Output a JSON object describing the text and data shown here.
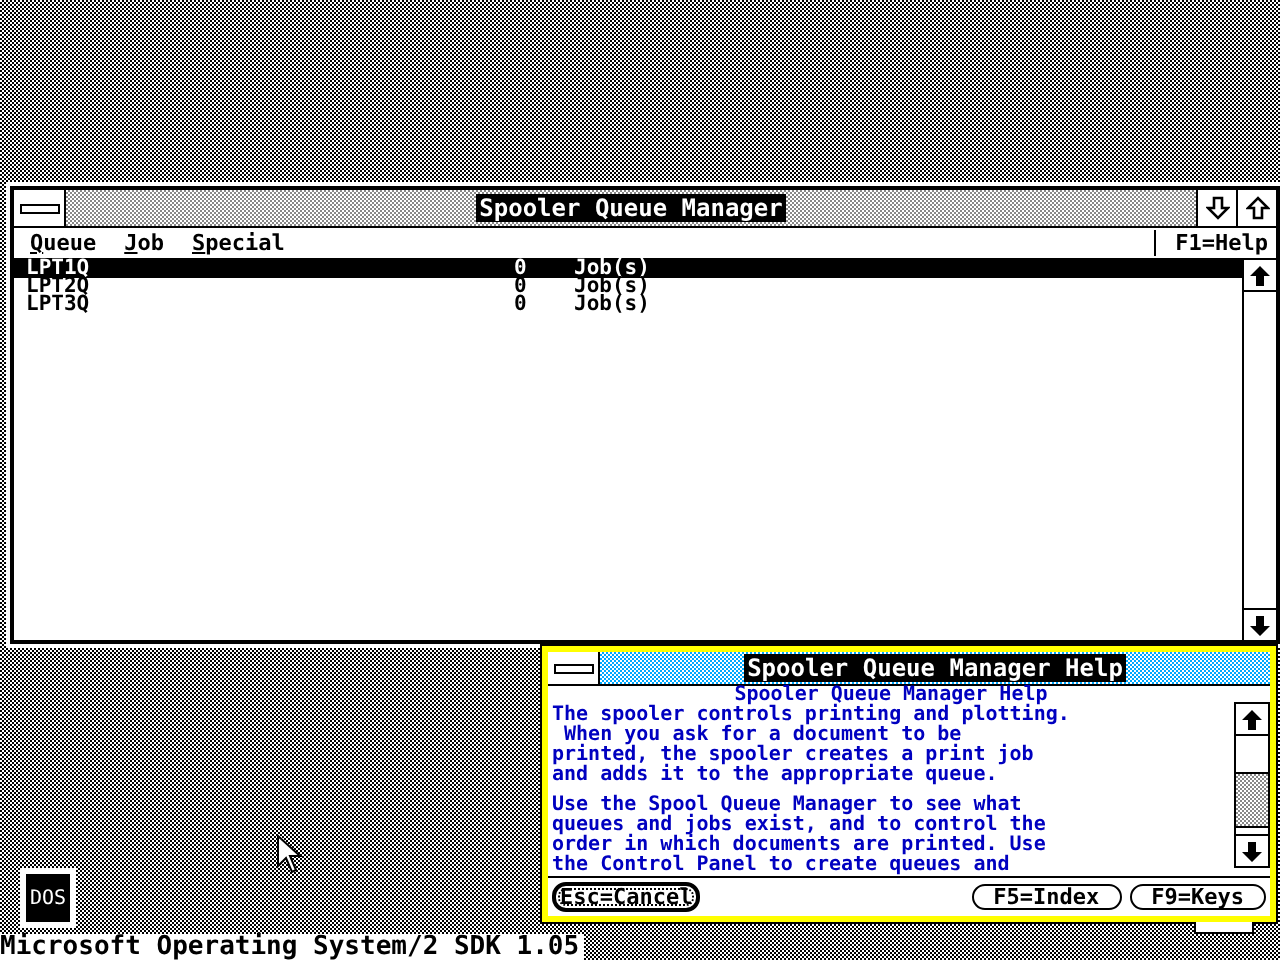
{
  "main_window": {
    "title": "Spooler Queue Manager",
    "menu": [
      {
        "label": "Queue"
      },
      {
        "label": "Job"
      },
      {
        "label": "Special"
      }
    ],
    "help_hint": "F1=Help",
    "queues": [
      {
        "name": "LPT1Q",
        "count": "0",
        "unit": "Job(s)",
        "selected": true
      },
      {
        "name": "LPT2Q",
        "count": "0",
        "unit": "Job(s)",
        "selected": false
      },
      {
        "name": "LPT3Q",
        "count": "0",
        "unit": "Job(s)",
        "selected": false
      }
    ]
  },
  "help_window": {
    "title": "Spooler Queue Manager Help",
    "heading": "Spooler Queue Manager Help",
    "paragraphs": [
      [
        "The spooler controls printing and plotting.",
        " When you ask for a document to be",
        "printed, the spooler creates a print job",
        "and adds it to the appropriate queue."
      ],
      [
        "Use the Spool Queue Manager to see what",
        "queues and jobs exist, and to control the",
        "order in which documents are printed. Use",
        "the Control Panel to create queues and"
      ]
    ],
    "buttons": [
      {
        "label": "Esc=Cancel",
        "selected": true
      },
      {
        "label": "F5=Index",
        "selected": false
      },
      {
        "label": "F9=Keys",
        "selected": false
      }
    ]
  },
  "desktop_icons": [
    {
      "label": "DOS"
    }
  ],
  "status_text": "Microsoft Operating System/2 SDK 1.05"
}
